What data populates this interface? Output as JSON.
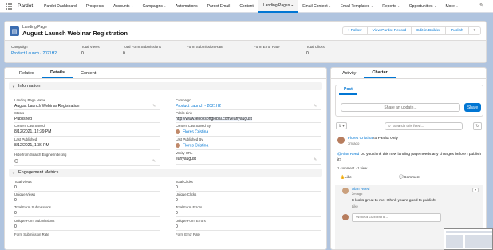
{
  "nav": {
    "app_name": "Pardot",
    "items": [
      {
        "label": "Pardot Dashboard",
        "dropdown": false
      },
      {
        "label": "Prospects",
        "dropdown": false
      },
      {
        "label": "Accounts",
        "dropdown": true
      },
      {
        "label": "Campaigns",
        "dropdown": true
      },
      {
        "label": "Automations",
        "dropdown": false
      },
      {
        "label": "Pardot Email",
        "dropdown": false
      },
      {
        "label": "Content",
        "dropdown": false
      },
      {
        "label": "Landing Pages",
        "dropdown": true,
        "active": true
      },
      {
        "label": "Email Content",
        "dropdown": true
      },
      {
        "label": "Email Templates",
        "dropdown": true
      },
      {
        "label": "Reports",
        "dropdown": true
      },
      {
        "label": "Opportunities",
        "dropdown": true
      },
      {
        "label": "More",
        "dropdown": true
      }
    ]
  },
  "header": {
    "record_type": "Landing Page",
    "title": "August Launch Webinar Registration",
    "actions": [
      "+ Follow",
      "View Pardot Record",
      "Edit in Builder",
      "Publish"
    ]
  },
  "highlights": {
    "campaign_label": "Campaign",
    "campaign_value": "Product Launch - 2021H2",
    "total_views_label": "Total Views",
    "total_views_value": "0",
    "total_form_submissions_label": "Total Form Submissions",
    "total_form_submissions_value": "0",
    "form_submission_rate_label": "Form Submission Rate",
    "form_error_rate_label": "Form Error Rate",
    "total_clicks_label": "Total Clicks",
    "total_clicks_value": "0"
  },
  "main": {
    "tabs": [
      "Related",
      "Details",
      "Content"
    ],
    "active_tab": "Details",
    "info_section": "Information",
    "engagement_section": "Engagement Metrics",
    "fields": {
      "name_label": "Landing Page Name",
      "name_value": "August Launch Webinar Registration",
      "campaign_label": "Campaign",
      "campaign_value": "Product Launch - 2021H2",
      "status_label": "Status",
      "status_value": "Published",
      "public_link_label": "Public Link",
      "public_link_value": "http://www.lenoxsoftglobal.com/earlyaugust",
      "last_saved_label": "Content Last Saved",
      "last_saved_value": "8/12/2021, 12:39 PM",
      "saved_by_label": "Content Last Saved By",
      "saved_by_value": "Flores Cristina",
      "last_published_label": "Last Published",
      "last_published_value": "8/12/2021, 1:36 PM",
      "published_by_label": "Last Published By",
      "published_by_value": "Flores Cristina",
      "hide_label": "Hide from Search Engine Indexing",
      "vanity_label": "Vanity URL",
      "vanity_value": "earlyaugust"
    },
    "metrics": {
      "total_views_label": "Total Views",
      "total_views_value": "0",
      "total_clicks_label": "Total Clicks",
      "total_clicks_value": "0",
      "unique_views_label": "Unique Views",
      "unique_views_value": "0",
      "unique_clicks_label": "Unique Clicks",
      "unique_clicks_value": "0",
      "total_form_submissions_label": "Total Form Submissions",
      "total_form_submissions_value": "0",
      "total_form_errors_label": "Total Form Errors",
      "total_form_errors_value": "0",
      "unique_form_submissions_label": "Unique Form Submissions",
      "unique_form_submissions_value": "0",
      "unique_form_errors_label": "Unique Form Errors",
      "unique_form_errors_value": "0",
      "form_submission_rate_label": "Form Submission Rate",
      "form_error_rate_label": "Form Error Rate"
    }
  },
  "chatter": {
    "tabs": [
      "Activity",
      "Chatter"
    ],
    "active_tab": "Chatter",
    "post_tab": "Post",
    "share_placeholder": "Share an update...",
    "share_button": "Share",
    "search_placeholder": "Search this feed...",
    "post": {
      "author": "Flores Cristina",
      "target": " to Pardot Only",
      "time": "3m ago",
      "mention": "@Alan Reed",
      "body": " Do you think this new landing page needs any changes before I publish it?",
      "stats": "1 comment · 1 view",
      "like_label": "Like",
      "comment_label": "Comment"
    },
    "comment": {
      "author": "Alan Reed",
      "date": "2m ago",
      "text": "It looks great to me. I think you're good to publish!",
      "like_label": "Like",
      "write_placeholder": "Write a comment..."
    }
  },
  "colors": {
    "brand_blue": "#0176d3",
    "page_background": "#b0c4df"
  }
}
